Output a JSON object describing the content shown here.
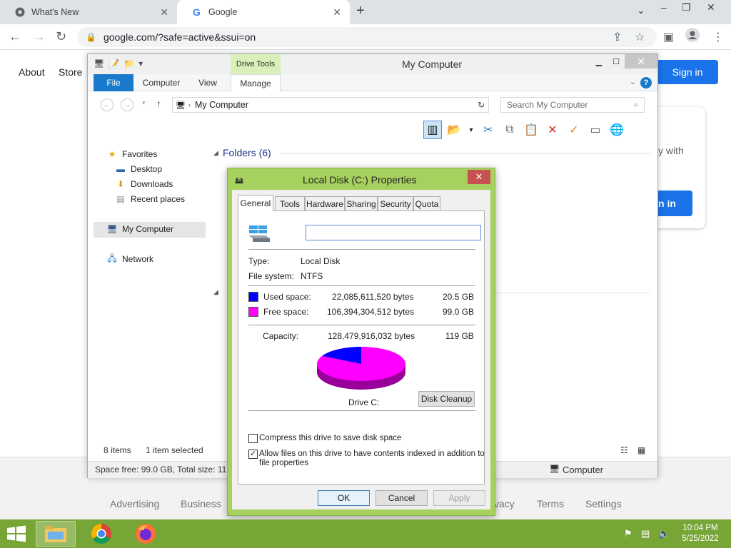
{
  "browser": {
    "tabs": [
      {
        "title": "What's New",
        "active": false
      },
      {
        "title": "Google",
        "active": true
      }
    ],
    "url": "google.com/?safe=active&ssui=on"
  },
  "google_page": {
    "links_left": [
      "About",
      "Store"
    ],
    "sign_in": "Sign in",
    "card_text": "y with",
    "card_button": "n in",
    "footer_links": [
      "Advertising",
      "Business",
      "vacy",
      "Terms",
      "Settings"
    ]
  },
  "explorer": {
    "title": "My Computer",
    "contextual_tab": "Drive Tools",
    "ribbon_tabs": [
      "File",
      "Computer",
      "View",
      "Manage"
    ],
    "address": "My Computer",
    "search_placeholder": "Search My Computer",
    "nav": {
      "favorites": "Favorites",
      "desktop": "Desktop",
      "downloads": "Downloads",
      "recent": "Recent places",
      "my_computer": "My Computer",
      "network": "Network"
    },
    "folders_header": "Folders (6)",
    "status_items": "8 items",
    "status_selected": "1 item selected",
    "details_text": "Space free: 99.0 GB, Total size: 119 G",
    "details_location": "Computer"
  },
  "properties": {
    "title": "Local Disk (C:) Properties",
    "tabs": [
      "General",
      "Tools",
      "Hardware",
      "Sharing",
      "Security",
      "Quota"
    ],
    "active_tab": "General",
    "name_value": "",
    "type_label": "Type:",
    "type_value": "Local Disk",
    "fs_label": "File system:",
    "fs_value": "NTFS",
    "used_label": "Used space:",
    "used_bytes": "22,085,611,520 bytes",
    "used_gb": "20.5 GB",
    "free_label": "Free space:",
    "free_bytes": "106,394,304,512 bytes",
    "free_gb": "99.0 GB",
    "cap_label": "Capacity:",
    "cap_bytes": "128,479,916,032 bytes",
    "cap_gb": "119 GB",
    "drive_label": "Drive C:",
    "cleanup_button": "Disk Cleanup",
    "compress_label": "Compress this drive to save disk space",
    "compress_checked": false,
    "index_label_1": "Allow files on this drive to have contents indexed in addition to",
    "index_label_2": "file properties",
    "index_checked": true,
    "ok": "OK",
    "cancel": "Cancel",
    "apply": "Apply",
    "used_color": "#0000ff",
    "free_color": "#ff00ff"
  },
  "taskbar": {
    "time": "10:04 PM",
    "date": "5/25/2022",
    "accent": "#77a536"
  }
}
